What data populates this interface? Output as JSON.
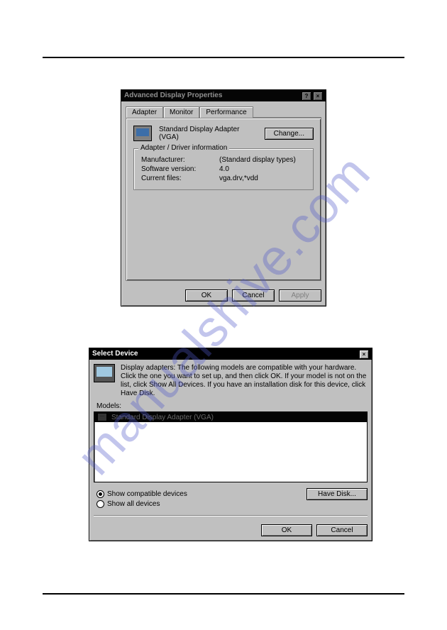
{
  "watermark": "manualshive.com",
  "dialog1": {
    "title": "Advanced Display Properties",
    "help_glyph": "?",
    "close_glyph": "×",
    "tabs": {
      "adapter": "Adapter",
      "monitor": "Monitor",
      "performance": "Performance"
    },
    "adapter_name": "Standard Display Adapter (VGA)",
    "change_btn": "Change...",
    "group_title": "Adapter / Driver information",
    "rows": {
      "manufacturer_k": "Manufacturer:",
      "manufacturer_v": "(Standard display types)",
      "version_k": "Software version:",
      "version_v": "4.0",
      "files_k": "Current files:",
      "files_v": "vga.drv,*vdd"
    },
    "buttons": {
      "ok": "OK",
      "cancel": "Cancel",
      "apply": "Apply"
    }
  },
  "dialog2": {
    "title": "Select Device",
    "close_glyph": "×",
    "description": "Display adapters: The following models are compatible with your hardware. Click the one you want to set up, and then click OK. If your model is not on the list, click Show All Devices. If you have an installation disk for this device, click Have Disk.",
    "models_label": "Models:",
    "model_item": "Standard Display Adapter (VGA)",
    "radios": {
      "compatible": "Show compatible devices",
      "all": "Show all devices"
    },
    "have_disk": "Have Disk...",
    "buttons": {
      "ok": "OK",
      "cancel": "Cancel"
    }
  }
}
